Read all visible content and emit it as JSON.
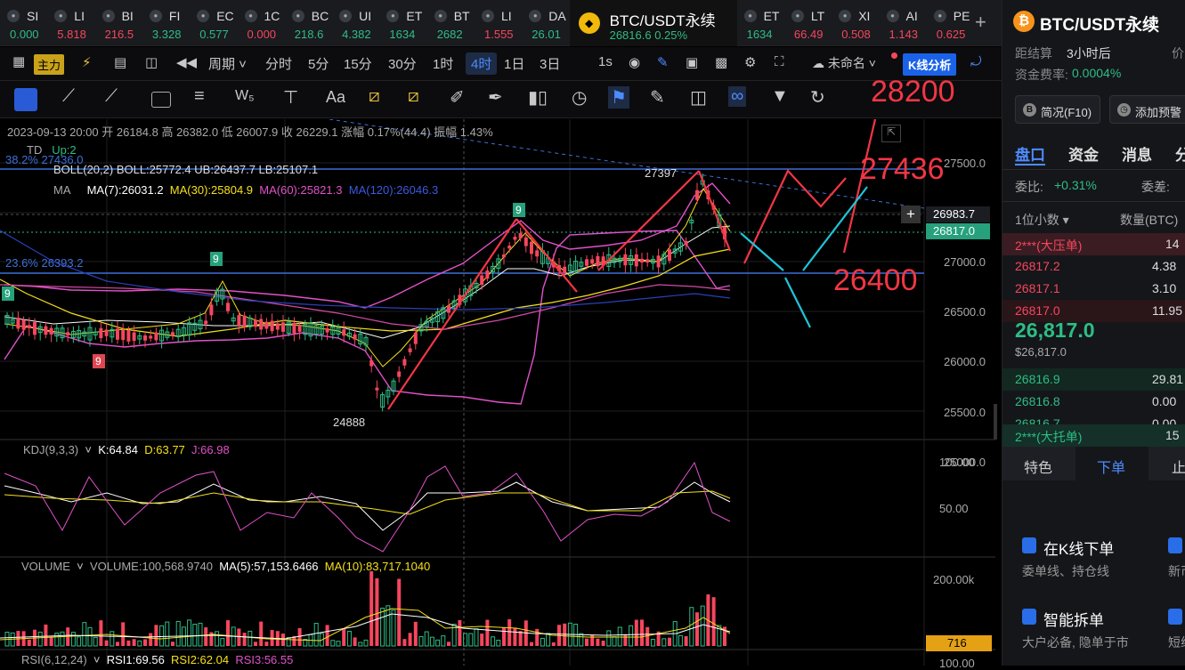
{
  "tabs": [
    {
      "name": "SI",
      "price": "0.000",
      "dir": "up"
    },
    {
      "name": "LI",
      "price": "5.818",
      "dir": "dn"
    },
    {
      "name": "BI",
      "price": "216.5",
      "dir": "dn"
    },
    {
      "name": "FI",
      "price": "3.328",
      "dir": "up"
    },
    {
      "name": "EC",
      "price": "0.577",
      "dir": "up"
    },
    {
      "name": "1C",
      "price": "0.000",
      "dir": "dn"
    },
    {
      "name": "BC",
      "price": "218.6",
      "dir": "up"
    },
    {
      "name": "UI",
      "price": "4.382",
      "dir": "up"
    },
    {
      "name": "ET",
      "price": "1634",
      "dir": "up"
    },
    {
      "name": "BT",
      "price": "2682",
      "dir": "up"
    },
    {
      "name": "LI",
      "price": "1.555",
      "dir": "dn"
    },
    {
      "name": "DA",
      "price": "26.01",
      "dir": "up"
    },
    {
      "name": "BTC/USDT永续",
      "price": "26816.6  0.25%",
      "dir": "up",
      "active": true
    },
    {
      "name": "ET",
      "price": "1634",
      "dir": "up"
    },
    {
      "name": "LT",
      "price": "66.49",
      "dir": "dn"
    },
    {
      "name": "XI",
      "price": "0.508",
      "dir": "dn"
    },
    {
      "name": "AI",
      "price": "1.143",
      "dir": "dn"
    },
    {
      "name": "PE",
      "price": "0.625",
      "dir": "dn"
    }
  ],
  "toolbar1": {
    "zhuli": "主力",
    "period": "周期",
    "timeframes": [
      "分时",
      "5分",
      "15分",
      "30分",
      "1时",
      "4时",
      "1日",
      "3日"
    ],
    "active_tf": "4时",
    "sec": "1s",
    "layout_name": "未命名",
    "kline_btn": "K线分析"
  },
  "toolbar2": {
    "aa": "Aa"
  },
  "info": {
    "ohlc": "2023-09-13 20:00  开 26184.8  高 26382.0  低 26007.9  收 26229.1  涨幅 0.17%(44.4)  振幅 1.43%",
    "td": "TD",
    "td_up": "Up:2",
    "boll": "BOLL(20,2)  BOLL:25772.4  UB:26437.7  LB:25107.1",
    "ma_label": "MA",
    "ma7": "MA(7):26031.2",
    "ma30": "MA(30):25804.9",
    "ma60": "MA(60):25821.3",
    "ma120": "MA(120):26046.3",
    "fib382": "38.2% 27436.0",
    "fib236": "23.6% 26393.2",
    "kdj": "KDJ(9,3,3)",
    "kdj_k": "K:64.84",
    "kdj_d": "D:63.77",
    "kdj_j": "J:66.98",
    "volume": "VOLUME",
    "vol_val": "VOLUME:100,568.9740",
    "vol_ma5": "MA(5):57,153.6466",
    "vol_ma10": "MA(10):83,717.1040",
    "rsi": "RSI(6,12,24)",
    "rsi1": "RSI1:69.56",
    "rsi2": "RSI2:62.04",
    "rsi3": "RSI3:56.55"
  },
  "axis": {
    "prices": [
      "27500.0",
      "27000.0",
      "26500.0",
      "26000.0",
      "25500.0",
      "25000.0"
    ],
    "crosshair": "26983.7",
    "last": "26817.0",
    "kdj": [
      "100.00",
      "50.00"
    ],
    "vol": [
      "200.00k"
    ],
    "vol_last": "716",
    "rsi": [
      "100.00"
    ]
  },
  "annotations": {
    "high": "27397",
    "low": "24888",
    "t9a": "9",
    "t9b": "9",
    "t9c": "9",
    "t9d": "9",
    "t28200": "28200",
    "t27436": "27436",
    "t26400": "26400"
  },
  "side": {
    "title": "BTC/USDT永续",
    "settle_label": "距结算",
    "settle_val": "3小时后",
    "price_label": "价",
    "fund_label": "资金费率:",
    "fund_val": "0.0004%",
    "btn1": "简况(F10)",
    "btn2": "添加预警",
    "tabs": [
      "盘口",
      "资金",
      "消息",
      "分"
    ],
    "weibi_label": "委比:",
    "weibi_val": "+0.31%",
    "weicha_label": "委差:",
    "decimals": "1位小数",
    "qty": "数量(BTC)",
    "ask_big": "2***(大压单)",
    "ask_big_q": "14",
    "asks": [
      {
        "p": "26817.2",
        "q": "4.38"
      },
      {
        "p": "26817.1",
        "q": "3.10"
      },
      {
        "p": "26817.0",
        "q": "11.95"
      }
    ],
    "last": "26,817.0",
    "last_usd": "$26,817.0",
    "bids": [
      {
        "p": "26816.9",
        "q": "29.81"
      },
      {
        "p": "26816.8",
        "q": "0.00"
      },
      {
        "p": "26816.7",
        "q": "0.00"
      }
    ],
    "bid_big": "2***(大托单)",
    "bid_big_q": "15",
    "bot_tabs": [
      "特色",
      "下单",
      "止"
    ],
    "card1": "在K线下单",
    "card1_sub": "委单线、持仓线",
    "card1b_sub": "新币",
    "card2": "智能拆单",
    "card2_sub": "大户必备, 隐单于市",
    "card2b_sub": "短线"
  }
}
